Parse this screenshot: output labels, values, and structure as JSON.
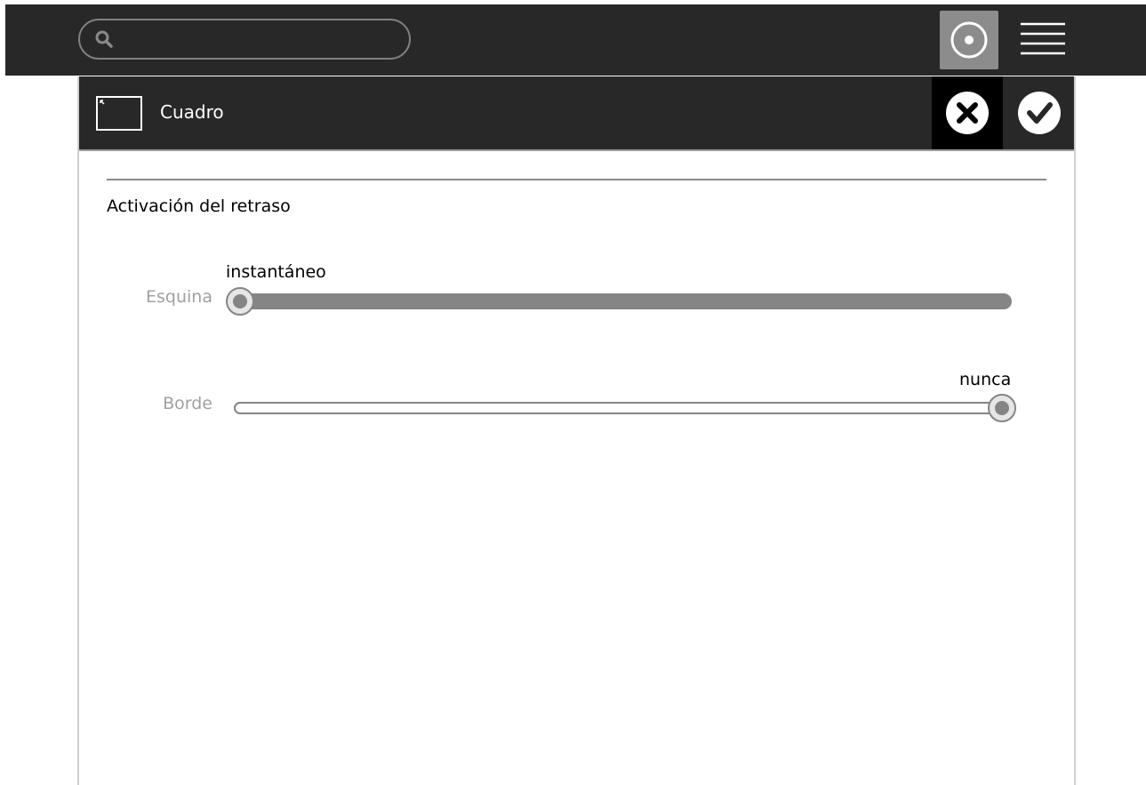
{
  "toolbar": {
    "search": {
      "placeholder": "",
      "value": "",
      "icon": "search-icon"
    },
    "activity_button": {
      "icon": "radio-dot-icon",
      "active_color": "#8c8c8c"
    },
    "menu_button": {
      "icon": "hamburger-icon"
    }
  },
  "panel": {
    "title": "Cuadro",
    "icon": "frame-icon",
    "cancel_icon": "close-icon",
    "accept_icon": "check-icon"
  },
  "section": {
    "title": "Activación del retraso"
  },
  "sliders": [
    {
      "label": "Esquina",
      "value_label": "instantáneo",
      "position": 0
    },
    {
      "label": "Borde",
      "value_label": "nunca",
      "position": 1
    }
  ],
  "colors": {
    "toolbar_bg": "#282828",
    "track": "#858585",
    "label_muted": "#a0a0a0"
  }
}
